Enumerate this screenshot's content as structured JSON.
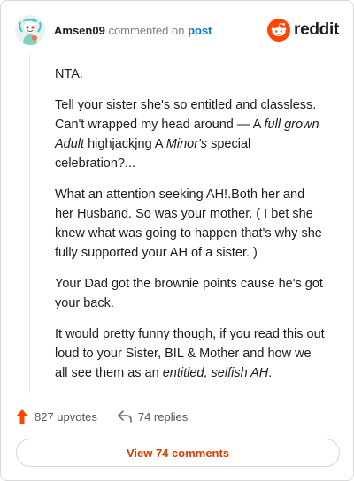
{
  "header": {
    "username": "Amsen09",
    "commented_text": "commented on",
    "post_link": "post",
    "brand_name": "reddit"
  },
  "comment": {
    "p1": "NTA.",
    "p2": {
      "a": "Tell your sister she's so entitled and classless. Can't wrapped my head around — A ",
      "b": "full grown Adult",
      "c": " highjackjng A ",
      "d": "Minor's",
      "e": " special celebration?..."
    },
    "p3": "What an attention seeking AH!.Both her and her Husband. So was your mother. ( I bet she knew what was going to happen that's why she fully supported your AH of a sister. )",
    "p4": "Your Dad got the brownie points cause he's got your back.",
    "p5": {
      "a": "It would pretty funny though, if you read this out loud to your Sister, BIL & Mother and how we all see them as an ",
      "b": "entitled, selfish AH",
      "c": "."
    }
  },
  "actions": {
    "upvotes": "827 upvotes",
    "replies": "74 replies",
    "view_comments": "View 74 comments"
  },
  "icons": {
    "avatar": "snoo-avatar",
    "brand": "reddit-alien-logo",
    "upvote": "upvote-arrow-icon",
    "reply": "reply-arrow-icon"
  },
  "colors": {
    "accent": "#ff4500",
    "link": "#0079d3",
    "button_text": "#d63c00"
  }
}
